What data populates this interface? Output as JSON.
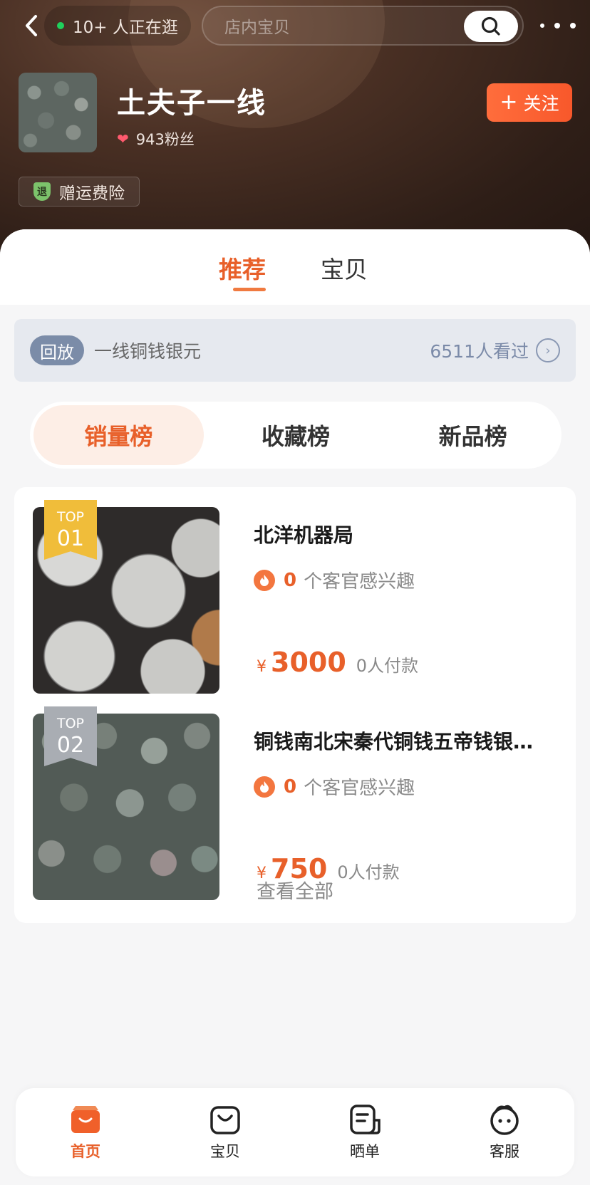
{
  "header": {
    "visitors": "10+ 人正在逛",
    "search_placeholder": "店内宝贝",
    "shop_name": "土夫子一线",
    "fans": "943粉丝",
    "follow_label": "关注",
    "insurance_badge": "退",
    "insurance_label": "赠运费险"
  },
  "tabs": [
    {
      "label": "推荐",
      "active": true
    },
    {
      "label": "宝贝",
      "active": false
    }
  ],
  "replay": {
    "tag": "回放",
    "title": "一线铜钱银元",
    "views": "6511人看过"
  },
  "rank_tabs": [
    {
      "label": "销量榜",
      "active": true
    },
    {
      "label": "收藏榜",
      "active": false
    },
    {
      "label": "新品榜",
      "active": false
    }
  ],
  "items": [
    {
      "rank_top": "TOP",
      "rank_num": "01",
      "title": "北洋机器局",
      "interest_count": "0",
      "interest_text": "个客官感兴趣",
      "currency": "¥",
      "price": "3000",
      "paid": "0人付款"
    },
    {
      "rank_top": "TOP",
      "rank_num": "02",
      "title": "铜钱南北宋秦代铜钱五帝钱银…",
      "interest_count": "0",
      "interest_text": "个客官感兴趣",
      "currency": "¥",
      "price": "750",
      "paid": "0人付款"
    }
  ],
  "view_all": "查看全部",
  "bottom_nav": [
    {
      "label": "首页",
      "icon": "shop-home-icon",
      "active": true
    },
    {
      "label": "宝贝",
      "icon": "bag-icon",
      "active": false
    },
    {
      "label": "晒单",
      "icon": "review-icon",
      "active": false
    },
    {
      "label": "客服",
      "icon": "service-icon",
      "active": false
    }
  ],
  "colors": {
    "accent": "#e8602a",
    "header_bg": "#3a261d",
    "replay_bg": "#e6e9ef"
  }
}
